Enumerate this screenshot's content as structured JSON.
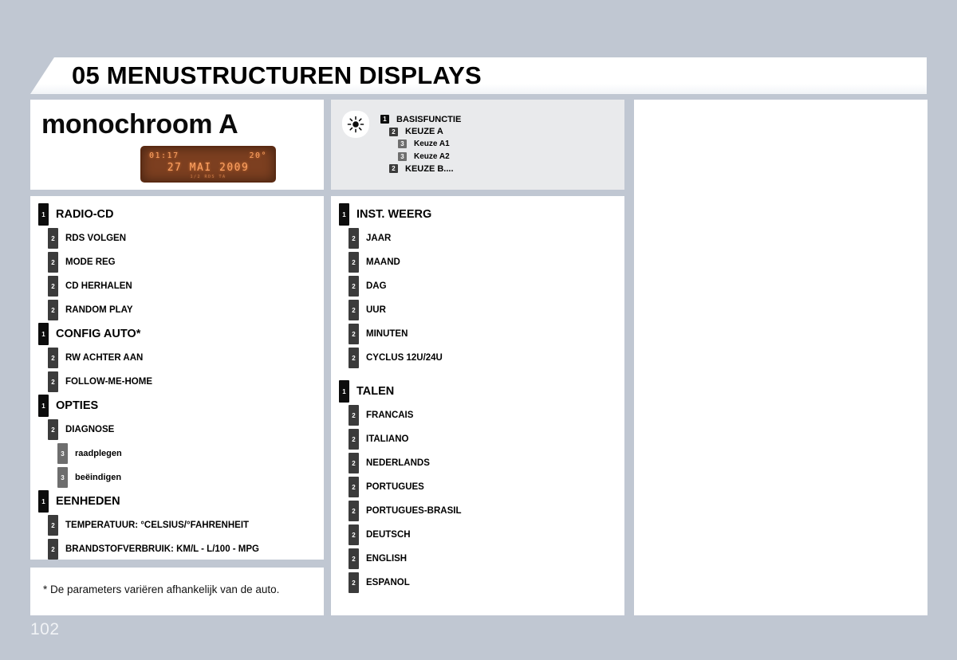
{
  "header": {
    "chapter_title": "05 MENUSTRUCTUREN DISPLAYS"
  },
  "title_panel": {
    "heading": "monochroom A",
    "display": {
      "clock": "01:17",
      "temperature": "20°",
      "date": "27 MAI 2009",
      "sub_row": "1/2   RDS  TA"
    }
  },
  "legend": {
    "icon": "sun-brightness-icon",
    "rows": [
      {
        "level": "1",
        "label": "BASISFUNCTIE",
        "indent": 0
      },
      {
        "level": "2",
        "label": "KEUZE A",
        "indent": 1
      },
      {
        "level": "3",
        "label": "Keuze A1",
        "indent": 2
      },
      {
        "level": "3",
        "label": "Keuze A2",
        "indent": 2
      },
      {
        "level": "2",
        "label": "KEUZE B....",
        "indent": 1
      }
    ]
  },
  "left_column": [
    {
      "level": "1",
      "label": "RADIO-CD",
      "indent": 0,
      "gap": false
    },
    {
      "level": "2",
      "label": "RDS VOLGEN",
      "indent": 1,
      "gap": false
    },
    {
      "level": "2",
      "label": "MODE REG",
      "indent": 1,
      "gap": false
    },
    {
      "level": "2",
      "label": "CD HERHALEN",
      "indent": 1,
      "gap": false
    },
    {
      "level": "2",
      "label": "RANDOM PLAY",
      "indent": 1,
      "gap": false
    },
    {
      "level": "1",
      "label": "CONFIG AUTO*",
      "indent": 0,
      "gap": false
    },
    {
      "level": "2",
      "label": "RW ACHTER AAN",
      "indent": 1,
      "gap": false
    },
    {
      "level": "2",
      "label": "FOLLOW-ME-HOME",
      "indent": 1,
      "gap": false
    },
    {
      "level": "1",
      "label": "OPTIES",
      "indent": 0,
      "gap": false
    },
    {
      "level": "2",
      "label": "DIAGNOSE",
      "indent": 1,
      "gap": false
    },
    {
      "level": "3",
      "label": "raadplegen",
      "indent": 2,
      "gap": false
    },
    {
      "level": "3",
      "label": "beëindigen",
      "indent": 2,
      "gap": false
    },
    {
      "level": "1",
      "label": "EENHEDEN",
      "indent": 0,
      "gap": false
    },
    {
      "level": "2",
      "label": "TEMPERATUUR: °CELSIUS/°FAHRENHEIT",
      "indent": 1,
      "gap": false
    },
    {
      "level": "2",
      "label": "BRANDSTOFVERBRUIK: KM/L - L/100 - MPG",
      "indent": 1,
      "gap": false
    }
  ],
  "middle_column": [
    {
      "level": "1",
      "label": "INST. WEERG",
      "indent": 0,
      "gap": false
    },
    {
      "level": "2",
      "label": "JAAR",
      "indent": 1,
      "gap": false
    },
    {
      "level": "2",
      "label": "MAAND",
      "indent": 1,
      "gap": false
    },
    {
      "level": "2",
      "label": "DAG",
      "indent": 1,
      "gap": false
    },
    {
      "level": "2",
      "label": "UUR",
      "indent": 1,
      "gap": false
    },
    {
      "level": "2",
      "label": "MINUTEN",
      "indent": 1,
      "gap": false
    },
    {
      "level": "2",
      "label": "CYCLUS 12U/24U",
      "indent": 1,
      "gap": false
    },
    {
      "level": "1",
      "label": "TALEN",
      "indent": 0,
      "gap": true
    },
    {
      "level": "2",
      "label": "FRANCAIS",
      "indent": 1,
      "gap": false
    },
    {
      "level": "2",
      "label": "ITALIANO",
      "indent": 1,
      "gap": false
    },
    {
      "level": "2",
      "label": "NEDERLANDS",
      "indent": 1,
      "gap": false
    },
    {
      "level": "2",
      "label": "PORTUGUES",
      "indent": 1,
      "gap": false
    },
    {
      "level": "2",
      "label": "PORTUGUES-BRASIL",
      "indent": 1,
      "gap": false
    },
    {
      "level": "2",
      "label": "DEUTSCH",
      "indent": 1,
      "gap": false
    },
    {
      "level": "2",
      "label": "ENGLISH",
      "indent": 1,
      "gap": false
    },
    {
      "level": "2",
      "label": "ESPANOL",
      "indent": 1,
      "gap": false
    }
  ],
  "right_column": [],
  "footnote": {
    "text": "* De parameters variëren afhankelijk van de auto."
  },
  "page_number": "102",
  "colors": {
    "page_background": "#c0c7d2",
    "panel_background": "#ffffff",
    "legend_background": "#e9eaec",
    "level1_badge": "#0d0d0d",
    "level2_badge": "#3b3b3b",
    "level3_badge": "#6e6e6e",
    "display_background": "#7c3f20",
    "display_text": "#ffa363",
    "page_number_color": "#f1f3f6"
  }
}
